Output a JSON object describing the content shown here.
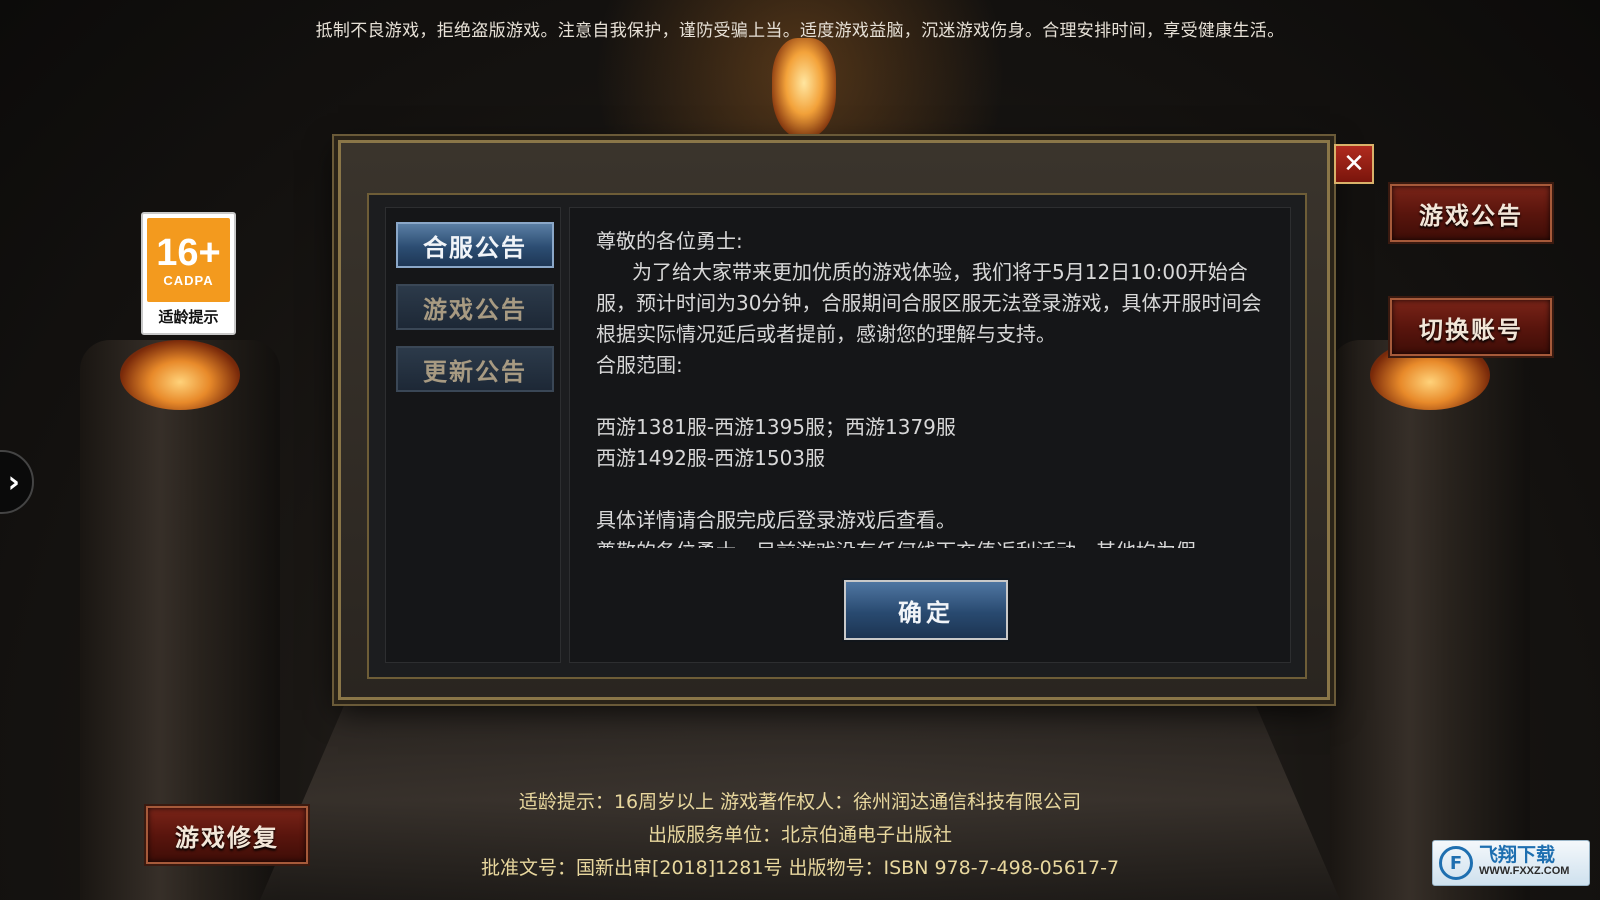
{
  "header": {
    "warning": "抵制不良游戏，拒绝盗版游戏。注意自我保护，谨防受骗上当。适度游戏益脑，沉迷游戏伤身。合理安排时间，享受健康生活。"
  },
  "age_badge": {
    "rating": "16+",
    "org": "CADPA",
    "label": "适龄提示"
  },
  "side_arrow": {
    "icon": "chevron-right-icon",
    "glyph": "›"
  },
  "right_buttons": {
    "notice": "游戏公告",
    "switch_account": "切换账号"
  },
  "left_buttons": {
    "repair": "游戏修复"
  },
  "dialog": {
    "close_glyph": "✕",
    "tabs": [
      {
        "label": "合服公告",
        "active": true
      },
      {
        "label": "游戏公告",
        "active": false
      },
      {
        "label": "更新公告",
        "active": false
      }
    ],
    "content": {
      "greeting": "尊敬的各位勇士:",
      "paragraph1": "为了给大家带来更加优质的游戏体验，我们将于5月12日10:00开始合服，预计时间为30分钟，合服期间合服区服无法登录游戏，具体开服时间会根据实际情况延后或者提前，感谢您的理解与支持。",
      "scope_label": "合服范围:",
      "scope_line1": "西游1381服-西游1395服；西游1379服",
      "scope_line2": "西游1492服-西游1503服",
      "details": "具体详情请合服完成后登录游戏后查看。",
      "cutoff": "尊敬的各位勇士，目前游戏没有任何线下充值返利活动，其他均为假"
    },
    "confirm_label": "确定"
  },
  "footer": {
    "line1": "适龄提示：16周岁以上 游戏著作权人：徐州润达通信科技有限公司",
    "line2": "出版服务单位：北京伯通电子出版社",
    "line3": "批准文号：国新出审[2018]1281号 出版物号：ISBN 978-7-498-05617-7"
  },
  "watermark": {
    "name": "飞翔下载",
    "url": "WWW.FXXZ.COM"
  }
}
